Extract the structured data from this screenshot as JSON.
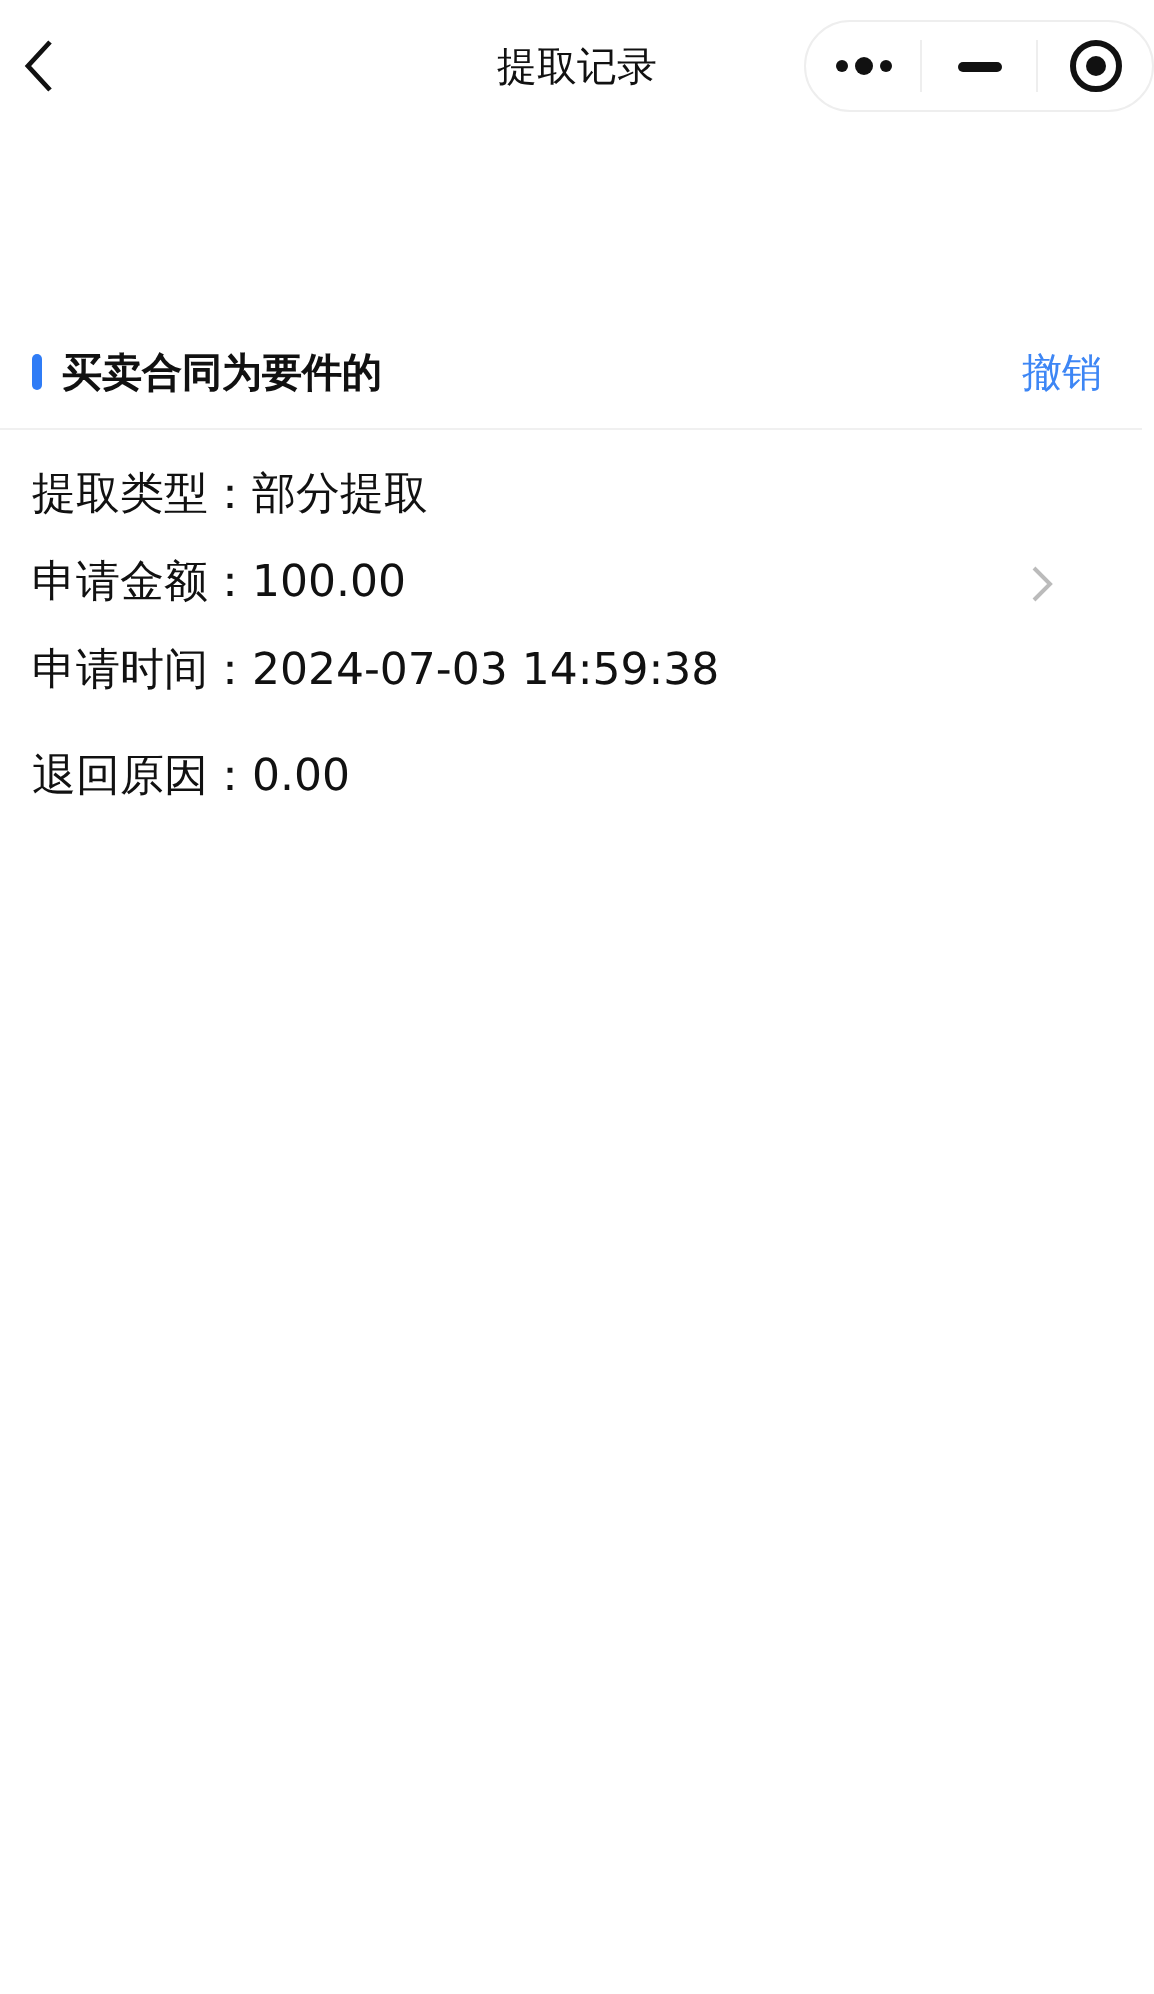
{
  "nav_bar": {
    "title": "提取记录"
  },
  "record": {
    "title": "买卖合同为要件的",
    "action": "撤销",
    "fields": [
      {
        "label": "提取类型：",
        "value": "部分提取"
      },
      {
        "label": "申请金额：",
        "value": "100.00"
      },
      {
        "label": "申请时间：",
        "value": "2024-07-03 14:59:38"
      }
    ],
    "reason": {
      "label": "退回原因：",
      "value": "0.00"
    }
  }
}
